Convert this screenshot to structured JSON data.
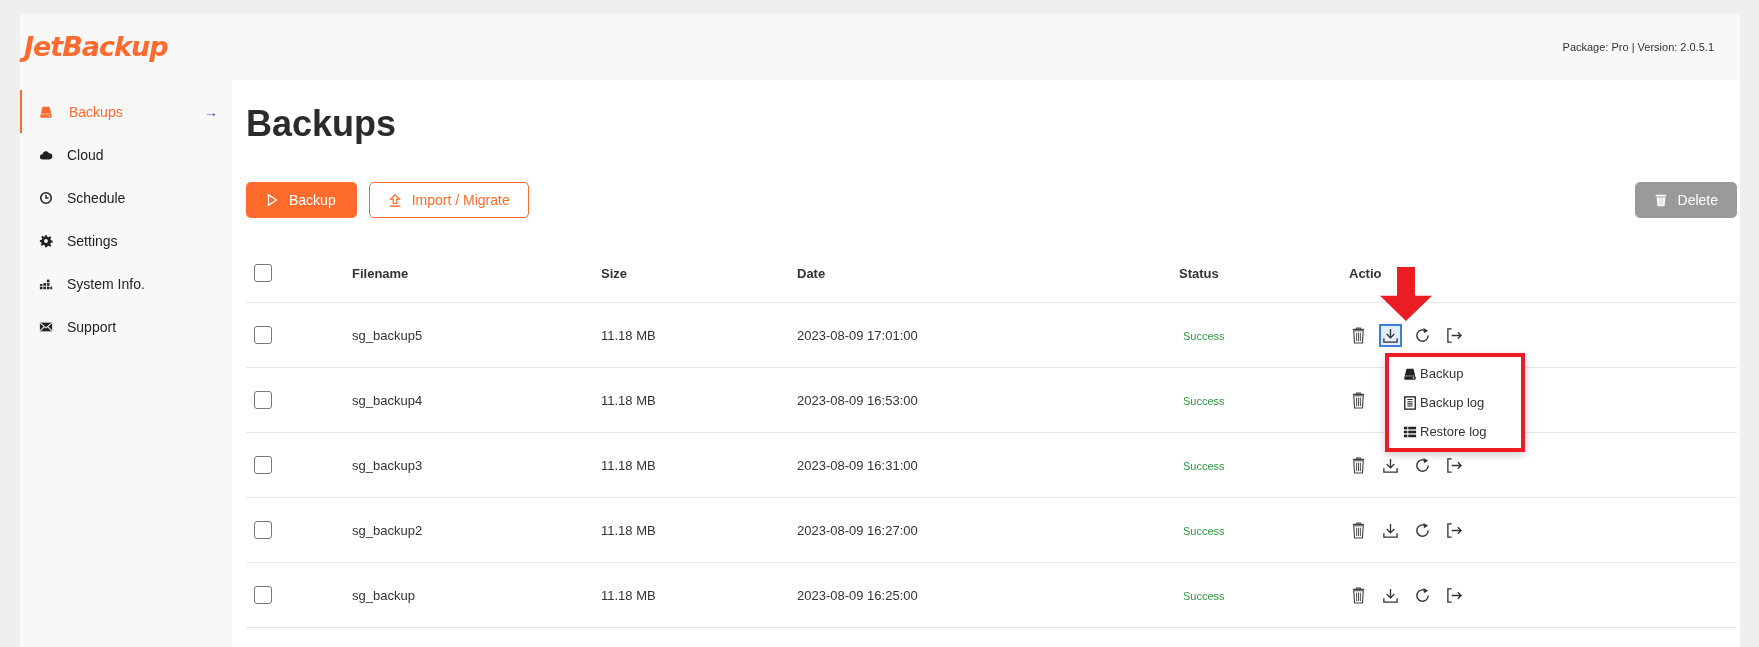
{
  "header": {
    "logo": "JetBackup",
    "package_info": "Package: Pro | Version: 2.0.5.1"
  },
  "sidebar": {
    "items": [
      {
        "label": "Backups",
        "selected": true,
        "arrow": "→"
      },
      {
        "label": "Cloud",
        "selected": false
      },
      {
        "label": "Schedule",
        "selected": false
      },
      {
        "label": "Settings",
        "selected": false
      },
      {
        "label": "System Info.",
        "selected": false
      },
      {
        "label": "Support",
        "selected": false
      }
    ]
  },
  "page_title": "Backups",
  "toolbar": {
    "buttons": [
      {
        "label": "Backup",
        "kind": "primary",
        "disabled": false
      },
      {
        "label": "Import / Migrate",
        "kind": "outline",
        "disabled": false
      },
      {
        "label": "Delete",
        "kind": "danger",
        "disabled": true
      }
    ]
  },
  "table": {
    "select_all": {
      "checked": false
    },
    "columns": [
      "Filename",
      "Size",
      "Date",
      "Status",
      "Actio"
    ],
    "rows": [
      {
        "checked": false,
        "filename": "sg_backup5",
        "size": "11.18 MB",
        "date": "2023-08-09 17:01:00",
        "status": "Success",
        "menu_open": true
      },
      {
        "checked": false,
        "filename": "sg_backup4",
        "size": "11.18 MB",
        "date": "2023-08-09 16:53:00",
        "status": "Success",
        "menu_open": false
      },
      {
        "checked": false,
        "filename": "sg_backup3",
        "size": "11.18 MB",
        "date": "2023-08-09 16:31:00",
        "status": "Success",
        "menu_open": false
      },
      {
        "checked": false,
        "filename": "sg_backup2",
        "size": "11.18 MB",
        "date": "2023-08-09 16:27:00",
        "status": "Success",
        "menu_open": false
      },
      {
        "checked": false,
        "filename": "sg_backup",
        "size": "11.18 MB",
        "date": "2023-08-09 16:25:00",
        "status": "Success",
        "menu_open": false
      }
    ]
  },
  "download_menu": {
    "items": [
      {
        "label": "Backup"
      },
      {
        "label": "Backup log"
      },
      {
        "label": "Restore log"
      }
    ]
  }
}
